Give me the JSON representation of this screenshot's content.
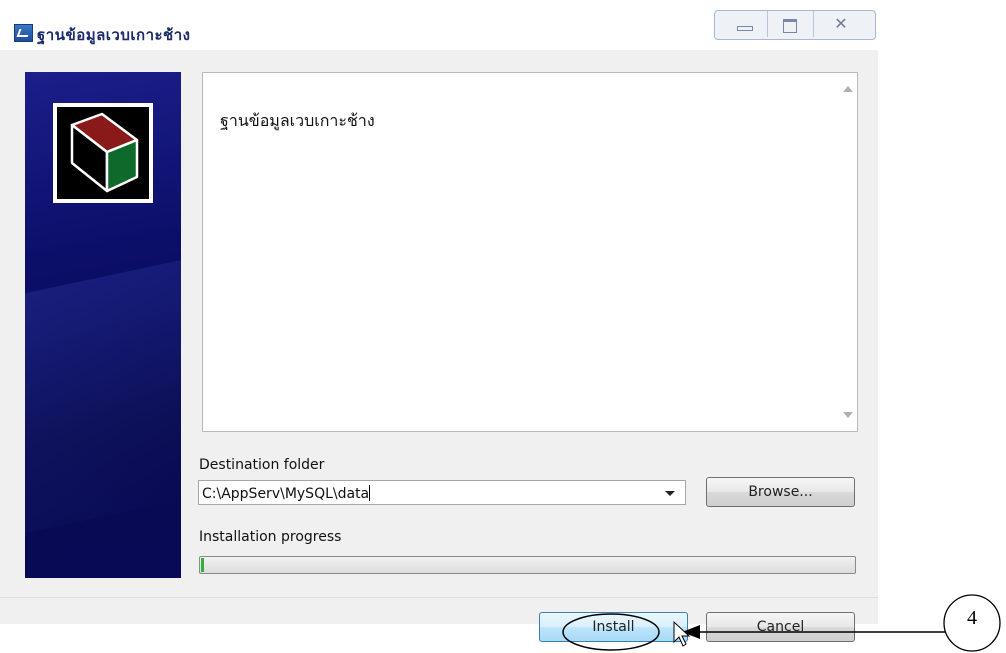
{
  "window": {
    "title": "ฐานข้อมูลเวบเกาะช้าง"
  },
  "title_buttons": {
    "close_glyph": "✕"
  },
  "content": {
    "text": "ฐานข้อมูลเวบเกาะช้าง"
  },
  "destination": {
    "label": "Destination folder",
    "value": "C:\\AppServ\\MySQL\\data"
  },
  "browse_label": "Browse...",
  "progress": {
    "label": "Installation progress",
    "fraction": 0.005
  },
  "buttons": {
    "install": "Install",
    "cancel": "Cancel"
  },
  "annotation": {
    "number": "4"
  },
  "colors": {
    "sidebar": "#0c0f6a",
    "progress_fill": "#2fb23a",
    "install_accent": "#a7d9f5"
  }
}
